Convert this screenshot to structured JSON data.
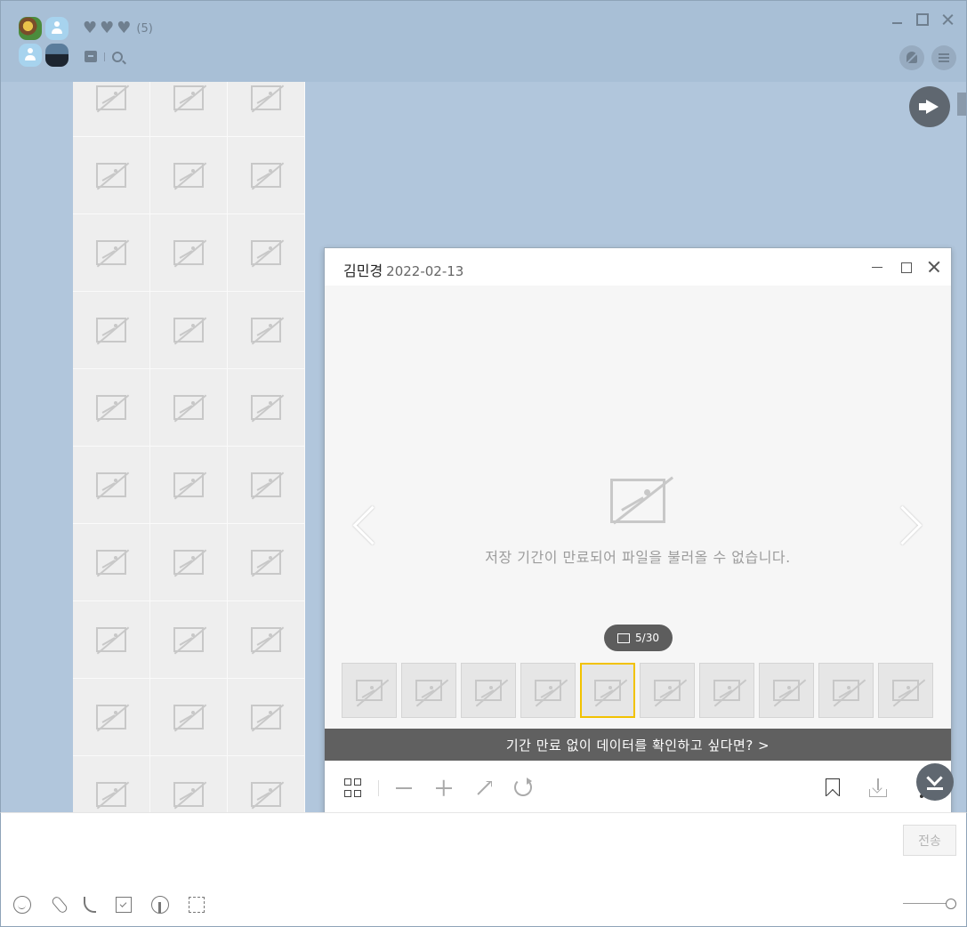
{
  "header": {
    "member_count": "(5)",
    "hearts": [
      "♥",
      "♥",
      "♥"
    ]
  },
  "viewer": {
    "sender": "김민경",
    "date": "2022-02-13",
    "expired_message": "저장 기간이 만료되어 파일을 불러올 수 없습니다.",
    "counter": "5/30",
    "current_index": 5,
    "total": 30,
    "visible_thumbnails": 10,
    "active_thumbnail": 5,
    "promo_text": "기간 만료 없이 데이터를 확인하고 싶다면? >"
  },
  "input": {
    "send_label": "전송"
  },
  "colors": {
    "background": "#b1c6dc",
    "header": "#a8bfd6",
    "active_thumbnail_border": "#f2c200",
    "promo_bar": "#606060"
  },
  "icons": {
    "header": [
      "heart-icon",
      "drawer-icon",
      "search-icon",
      "mute-notification-icon",
      "menu-icon"
    ],
    "viewer_toolbar": [
      "grid-view-icon",
      "zoom-out-icon",
      "zoom-in-icon",
      "fit-screen-icon",
      "rotate-icon",
      "bookmark-icon",
      "download-icon",
      "more-options-icon"
    ],
    "input_toolbar": [
      "emoji-icon",
      "attach-file-icon",
      "call-icon",
      "calendar-icon",
      "live-talk-icon",
      "screen-capture-icon"
    ]
  }
}
